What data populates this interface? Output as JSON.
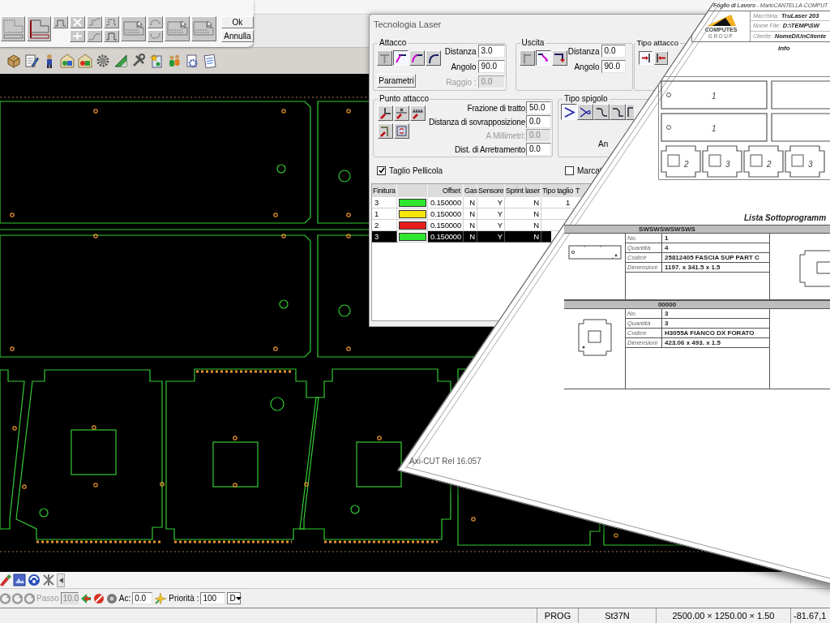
{
  "tool_panel": {
    "buttons": [
      "Ok",
      "Annulla"
    ]
  },
  "laser_dialog": {
    "title": "Tecnologia Laser",
    "attacco": {
      "legend": "Attacco",
      "options": [
        {
          "selected": false,
          "disabled": true
        },
        {
          "selected": true,
          "disabled": false
        },
        {
          "selected": false,
          "disabled": false
        },
        {
          "selected": false,
          "disabled": false
        }
      ],
      "button": "Parametri",
      "fields": [
        {
          "label": "Distanza",
          "value": "3.0",
          "disabled": false
        },
        {
          "label": "Angolo",
          "value": "90.0",
          "disabled": false
        },
        {
          "label": "Raggio :",
          "value": "0.0",
          "disabled": true
        }
      ]
    },
    "uscita": {
      "legend": "Uscita",
      "options": [
        {
          "selected": false,
          "disabled": true
        },
        {
          "selected": true,
          "disabled": false
        },
        {
          "selected": false,
          "disabled": false
        }
      ],
      "fields": [
        {
          "label": "Distanza",
          "value": "0.0",
          "disabled": false
        },
        {
          "label": "Angolo",
          "value": "90.0",
          "disabled": false
        }
      ]
    },
    "tipo_attacco": {
      "legend": "Tipo attacco",
      "options": [
        {
          "selected": true
        },
        {
          "selected": false
        }
      ]
    },
    "punto_attacco": {
      "legend": "Punto attacco",
      "fields": [
        {
          "label": "Frazione di tratto",
          "value": "50.0",
          "disabled": false
        },
        {
          "label": "Distanza di sovrapposizione",
          "value": "0.0",
          "disabled": false
        },
        {
          "label": "A Millimetri:",
          "value": "0.0",
          "disabled": true
        },
        {
          "label": "Dist. di Arretramento",
          "value": "0.0",
          "disabled": false
        }
      ]
    },
    "tipo_spigolo": {
      "legend": "Tipo spigolo",
      "options": [
        {
          "selected": true
        },
        {
          "selected": false
        },
        {
          "selected": false
        },
        {
          "selected": false
        },
        {
          "selected": false
        }
      ],
      "label": "An"
    },
    "checkboxes": [
      {
        "label": "Taglio Pellicola",
        "checked": true
      },
      {
        "label": "Marcat",
        "checked": false
      }
    ],
    "table": {
      "columns": [
        "Finitura",
        "Offset",
        "Gas",
        "Sensore",
        "Sprint laser",
        "Tipo taglio",
        "T"
      ],
      "rows": [
        {
          "color": "#2ee62e",
          "selected": false,
          "cells": [
            "3",
            "0.150000",
            "N",
            "Y",
            "N",
            "1"
          ]
        },
        {
          "color": "#f5e50a",
          "selected": false,
          "cells": [
            "1",
            "0.150000",
            "N",
            "Y",
            "N"
          ]
        },
        {
          "color": "#e51c1c",
          "selected": false,
          "cells": [
            "2",
            "0.150000",
            "N",
            "Y",
            "N"
          ]
        },
        {
          "color": "#2ee62e",
          "selected": true,
          "cells": [
            "3",
            "0.150000",
            "N",
            "Y",
            "N"
          ]
        }
      ]
    }
  },
  "bottom_toolbar": {
    "fields": [
      {
        "label": "Passo",
        "value": "10.0",
        "disabled": true
      },
      {
        "label": "Ac:",
        "value": "0.0",
        "disabled": false
      },
      {
        "label": "Priorità :",
        "value": "100",
        "disabled": false
      }
    ],
    "dropdown": "D"
  },
  "status_bar": {
    "cells": [
      "PROG",
      "St37N",
      "2500.00 × 1250.00 × 1.50",
      "-81.67,1"
    ]
  },
  "worksheet": {
    "title": "**Foglio di Lavoro** - MarioCANTELLA-COMPUT",
    "logo": {
      "name": "COMPUTES",
      "tagline": "GROUP"
    },
    "fields": [
      {
        "label": "Macchina:",
        "value": "TruLaser 203"
      },
      {
        "label": "Nome File:",
        "value": "D:\\TEMP\\SW"
      },
      {
        "label": "Cliente:",
        "value": "NomeDiUnCliente"
      }
    ],
    "section": "Info",
    "nest_labels": [
      "1",
      "1",
      "2",
      "3",
      "2",
      "3"
    ],
    "list_title": "Lista Sottoprogramm",
    "subprograms": [
      {
        "name": "SWSWSWSWSWS",
        "rows": [
          {
            "label": "No.",
            "value": "1"
          },
          {
            "label": "Quantità",
            "value": "4"
          },
          {
            "label": "Codice",
            "value": "25812405 FASCIA SUP PART C"
          },
          {
            "label": "Dimensioni",
            "value": "1197. x 341.5 x 1.5"
          }
        ]
      },
      {
        "name": "00000",
        "rows": [
          {
            "label": "No.",
            "value": "3"
          },
          {
            "label": "Quantità",
            "value": "3"
          },
          {
            "label": "Codice",
            "value": "H3055A FIANCO DX FORATO"
          },
          {
            "label": "Dimensioni",
            "value": "423.06 x 493. x 1.5"
          }
        ]
      }
    ],
    "footer": "Axi-CUT Rel 16.057"
  }
}
